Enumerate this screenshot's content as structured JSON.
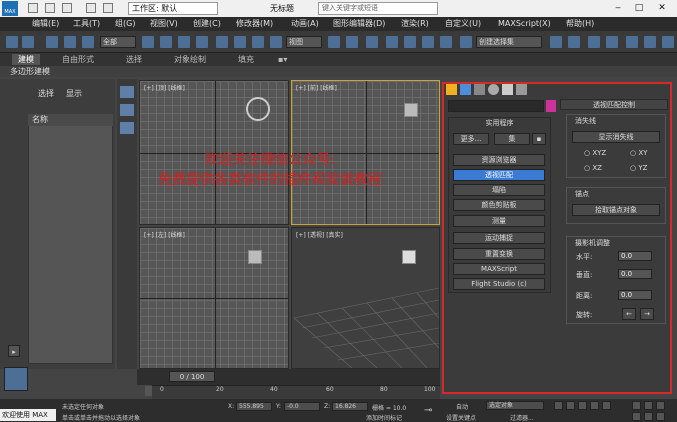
{
  "titlebar": {
    "logo_text": "MAX",
    "workspace": "工作区: 默认",
    "document_title": "无标题",
    "search_placeholder": "键入关键字或短语",
    "window_buttons": [
      "minimize-icon",
      "maximize-icon",
      "close-icon"
    ]
  },
  "menubar": {
    "items": [
      "编辑(E)",
      "工具(T)",
      "组(G)",
      "视图(V)",
      "创建(C)",
      "修改器(M)",
      "动画(A)",
      "图形编辑器(D)",
      "渲染(R)",
      "自定义(U)",
      "MAXScript(X)",
      "帮助(H)"
    ]
  },
  "toolbar": {
    "selection_filter": "全部",
    "reference_coord": "视图",
    "named_selection": "创建选择集"
  },
  "ribbon": {
    "tabs": [
      "建模",
      "自由形式",
      "选择",
      "对象绘制",
      "填充"
    ],
    "active": "建模",
    "sub_label": "多边形建模"
  },
  "left_panel": {
    "tab_select": "选择",
    "tab_display": "显示",
    "list_header": "名称"
  },
  "viewports": {
    "top": "[+] [顶] [线框]",
    "front": "[+] [前] [线框]",
    "left": "[+] [左] [线框]",
    "perspective": "[+] [透视] [真实]"
  },
  "watermark": {
    "line1": "欢迎关注微信公众号:",
    "line2": "免费提供各类软件的插件和安装教程"
  },
  "utilities": {
    "title": "实用程序",
    "more": "更多...",
    "sets": "集",
    "buttons": [
      "资源浏览器",
      "透视匹配",
      "塌陷",
      "颜色剪贴板",
      "测量",
      "运动捕捉",
      "重置变换",
      "MAXScript",
      "Flight Studio (c)"
    ],
    "selected_index": 1
  },
  "perspective_match": {
    "header": "透视匹配控制",
    "vanish_title": "消失线",
    "show_vanish": "显示消失线",
    "radio_options": [
      "XYZ",
      "XY",
      "XZ",
      "YZ"
    ],
    "vertex_title": "锚点",
    "pick_anchor": "拾取锚点对象",
    "camera_title": "摄影机调整",
    "h_label": "水平:",
    "v_label": "垂直:",
    "dist_label": "距离:",
    "rot_label": "旋转:",
    "h_value": "0.0",
    "v_value": "0.0",
    "dist_value": "0.0",
    "rot_value": "0.0"
  },
  "timeline": {
    "position": "0 / 100",
    "ticks": [
      "0",
      "20",
      "40",
      "60",
      "80",
      "100"
    ]
  },
  "statusbar": {
    "welcome": "欢迎使用 MAX",
    "status1": "未选定任何对象",
    "status2": "单击或单击并拖动以选择对象",
    "x_label": "X:",
    "x_value": "555.895",
    "y_label": "Y:",
    "y_value": "-0.0",
    "z_label": "Z:",
    "z_value": "16.826",
    "grid": "栅格 = 10.0",
    "add_time_tag": "添加时间标记",
    "auto": "自动",
    "selected": "选定对象",
    "set_key": "设置关键点",
    "filters": "过滤器..."
  }
}
